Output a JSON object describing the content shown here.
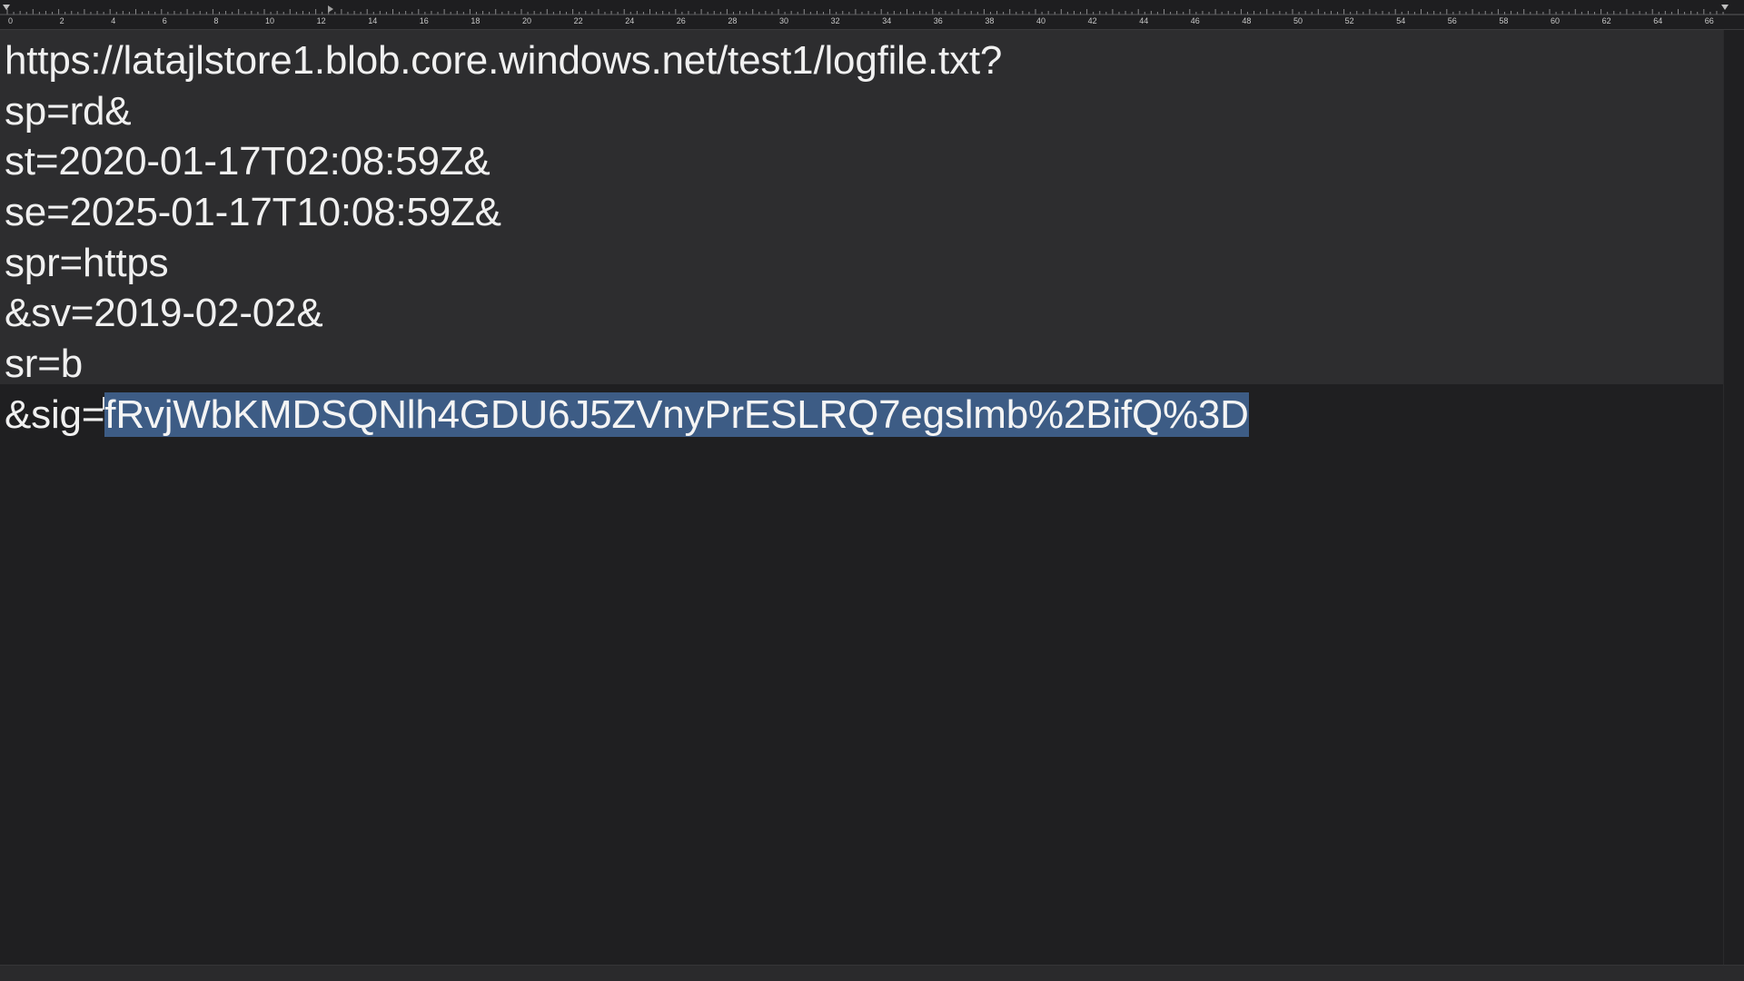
{
  "ruler": {
    "labels": [
      "0",
      "2",
      "4",
      "6",
      "8",
      "10",
      "12",
      "14",
      "16",
      "18",
      "20",
      "22",
      "24",
      "26",
      "28",
      "30",
      "32",
      "34",
      "36",
      "38",
      "40",
      "42",
      "44",
      "46",
      "48",
      "50",
      "52",
      "54",
      "56",
      "58",
      "60",
      "62",
      "64",
      "66"
    ]
  },
  "document": {
    "lines": [
      "https://latajlstore1.blob.core.windows.net/test1/logfile.txt?",
      "sp=rd&",
      "st=2020-01-17T02:08:59Z&",
      "se=2025-01-17T10:08:59Z&",
      "spr=https",
      "&sv=2019-02-02&",
      "sr=b"
    ],
    "sig_prefix": "&sig=",
    "sig_value": "fRvjWbKMDSQNlh4GDU6J5ZVnyPrESLRQ7egslmb%2BifQ%3D"
  },
  "colors": {
    "background": "#1f1f21",
    "block_background": "#2d2d2f",
    "selection": "#3d5c85",
    "text": "#f0f0f0"
  }
}
